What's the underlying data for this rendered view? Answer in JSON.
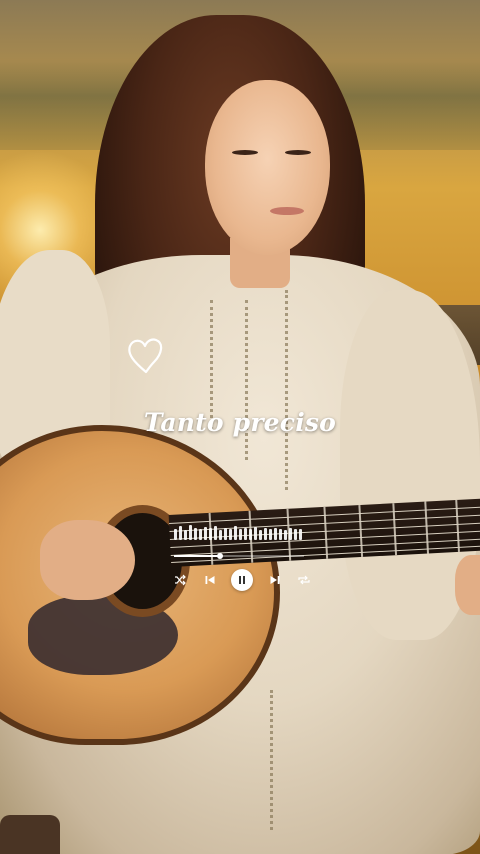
{
  "song": {
    "title": "Tanto preciso"
  },
  "player": {
    "progress": 0.35,
    "state": "playing",
    "equalizer_levels": [
      0.6,
      0.8,
      0.5,
      0.9,
      0.7,
      0.55,
      0.75,
      0.65,
      0.8,
      0.5,
      0.7,
      0.6,
      0.85,
      0.55,
      0.7,
      0.6,
      0.75,
      0.5,
      0.65,
      0.55,
      0.7,
      0.6,
      0.5,
      0.65,
      0.55,
      0.6
    ],
    "controls": [
      "shuffle-icon",
      "previous-icon",
      "pause-icon",
      "next-icon",
      "repeat-icon"
    ]
  },
  "colors": {
    "text": "#ffffff",
    "accent": "#d9a640"
  },
  "icons": {
    "heart": "heart-outline-icon"
  }
}
